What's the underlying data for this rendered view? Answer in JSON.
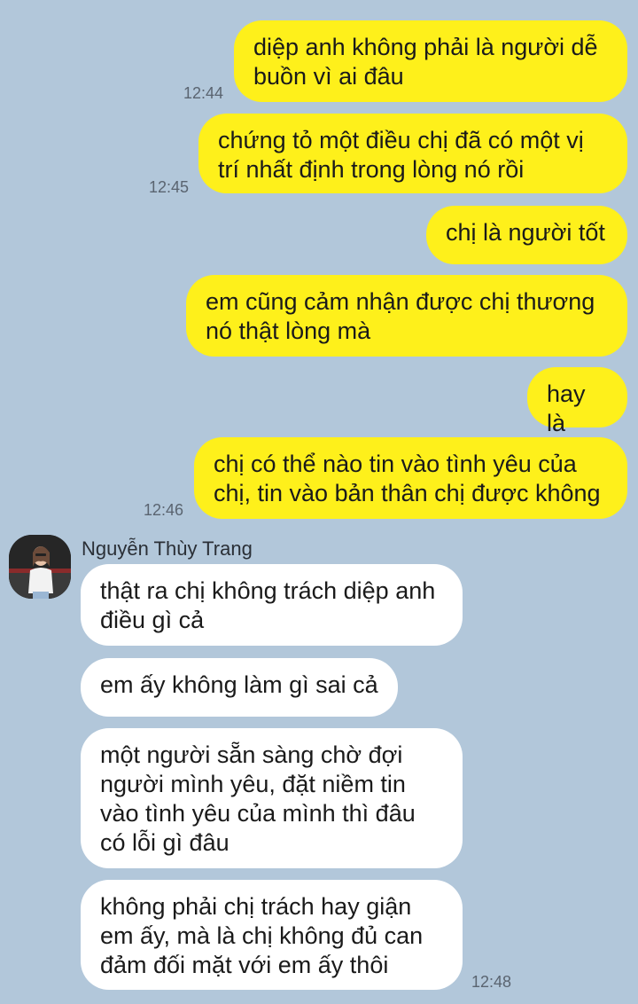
{
  "conversation": {
    "outgoing": [
      {
        "text": "diệp anh không phải là người dễ\nbuồn vì ai đâu",
        "time": "12:44"
      },
      {
        "text": "chứng tỏ một điều chị đã có một vị\ntrí nhất định trong lòng nó rồi",
        "time": "12:45"
      },
      {
        "text": "chị là người tốt",
        "time": ""
      },
      {
        "text": "em cũng cảm nhận được chị thương\nnó thật lòng mà",
        "time": ""
      },
      {
        "text": "hay là",
        "time": ""
      },
      {
        "text": "chị có thể nào tin vào tình yêu của\nchị, tin vào bản thân chị được không",
        "time": "12:46"
      }
    ],
    "contact": {
      "name": "Nguyễn Thùy Trang",
      "avatar_icon": "profile-photo"
    },
    "incoming": [
      {
        "text": "thật ra chị không trách diệp anh\nđiều gì cả",
        "time": ""
      },
      {
        "text": "em ấy không làm gì sai cả",
        "time": ""
      },
      {
        "text": "một người sẵn sàng chờ đợi\nngười mình yêu, đặt niềm tin\nvào tình yêu của mình thì đâu\ncó lỗi gì đâu",
        "time": ""
      },
      {
        "text": "không phải chị trách hay giận\nem ấy, mà là chị không đủ can\nđảm đối mặt với em ấy thôi",
        "time": "12:48"
      }
    ]
  },
  "colors": {
    "background": "#b2c7da",
    "outgoing_bubble": "#fef01b",
    "incoming_bubble": "#ffffff",
    "timestamp": "#5a6470"
  }
}
